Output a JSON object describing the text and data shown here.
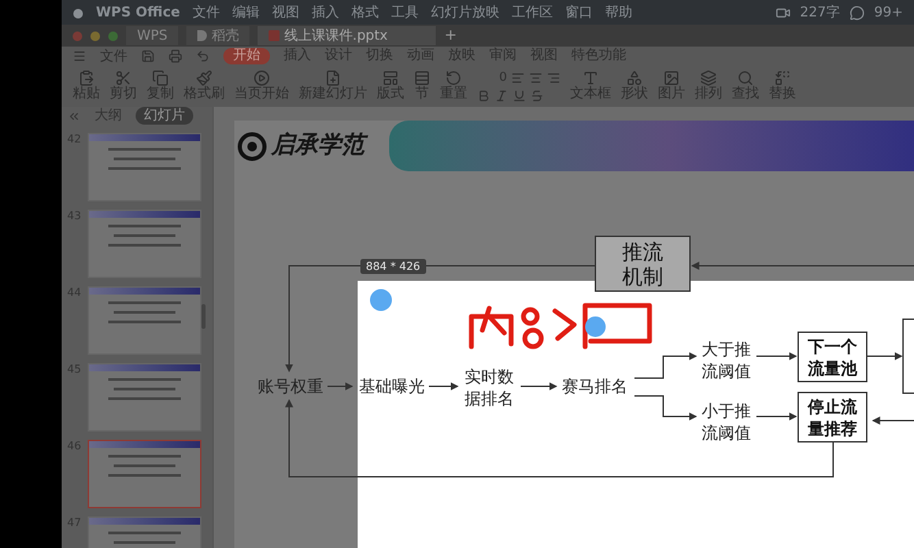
{
  "menu_bar": {
    "app": "WPS Office",
    "items": [
      "文件",
      "编辑",
      "视图",
      "插入",
      "格式",
      "工具",
      "幻灯片放映",
      "工作区",
      "窗口",
      "帮助"
    ],
    "status": [
      "227字",
      "99+"
    ]
  },
  "tabs": [
    {
      "label": "WPS",
      "kind": "home",
      "selected": false
    },
    {
      "label": "稻壳",
      "kind": "store",
      "selected": false
    },
    {
      "label": "线上课课件.pptx",
      "kind": "file",
      "selected": true
    }
  ],
  "new_tab": "+",
  "ribbon": {
    "menu": "文件",
    "tabs": [
      {
        "label": "开始",
        "selected": true
      },
      {
        "label": "插入",
        "selected": false
      },
      {
        "label": "设计",
        "selected": false
      },
      {
        "label": "切换",
        "selected": false
      },
      {
        "label": "动画",
        "selected": false
      },
      {
        "label": "放映",
        "selected": false
      },
      {
        "label": "审阅",
        "selected": false
      },
      {
        "label": "视图",
        "selected": false
      },
      {
        "label": "特色功能",
        "selected": false
      }
    ],
    "tools": [
      {
        "label": "粘贴",
        "kind": "paste"
      },
      {
        "label": "剪切",
        "kind": "cut"
      },
      {
        "label": "复制",
        "kind": "copy"
      },
      {
        "label": "格式刷",
        "kind": "brush"
      },
      {
        "label": "当页开始",
        "kind": "play"
      },
      {
        "label": "新建幻灯片",
        "kind": "new"
      },
      {
        "label": "版式",
        "kind": "layout"
      },
      {
        "label": "节",
        "kind": "section"
      },
      {
        "label": "重置",
        "kind": "reset"
      },
      {
        "label": "文本框",
        "kind": "textbox"
      },
      {
        "label": "形状",
        "kind": "shape"
      },
      {
        "label": "图片",
        "kind": "image"
      },
      {
        "label": "排列",
        "kind": "arrange"
      },
      {
        "label": "查找",
        "kind": "find"
      },
      {
        "label": "替换",
        "kind": "replace"
      }
    ],
    "font_size": "0"
  },
  "sidebar": {
    "tabs": [
      {
        "label": "大纲",
        "selected": false
      },
      {
        "label": "幻灯片",
        "selected": true
      }
    ],
    "slides": [
      {
        "number": "42",
        "selected": false
      },
      {
        "number": "43",
        "selected": false
      },
      {
        "number": "44",
        "selected": false
      },
      {
        "number": "45",
        "selected": false
      },
      {
        "number": "46",
        "selected": true
      },
      {
        "number": "47",
        "selected": false
      }
    ]
  },
  "slide": {
    "logo": "启承学范",
    "size_label": "884 * 426",
    "nodes": [
      {
        "text": "推流机制",
        "kind": "box"
      },
      {
        "text": "账号权重",
        "kind": "label"
      },
      {
        "text": "基础曝光",
        "kind": "label"
      },
      {
        "text": "实时数据排名",
        "kind": "label"
      },
      {
        "text": "赛马排名",
        "kind": "label"
      },
      {
        "text": "大于推流阈值",
        "kind": "label"
      },
      {
        "text": "小于推流阈值",
        "kind": "label"
      },
      {
        "text": "下一个流量池",
        "kind": "bold-box"
      },
      {
        "text": "停止流量推荐",
        "kind": "bold-box"
      }
    ]
  }
}
